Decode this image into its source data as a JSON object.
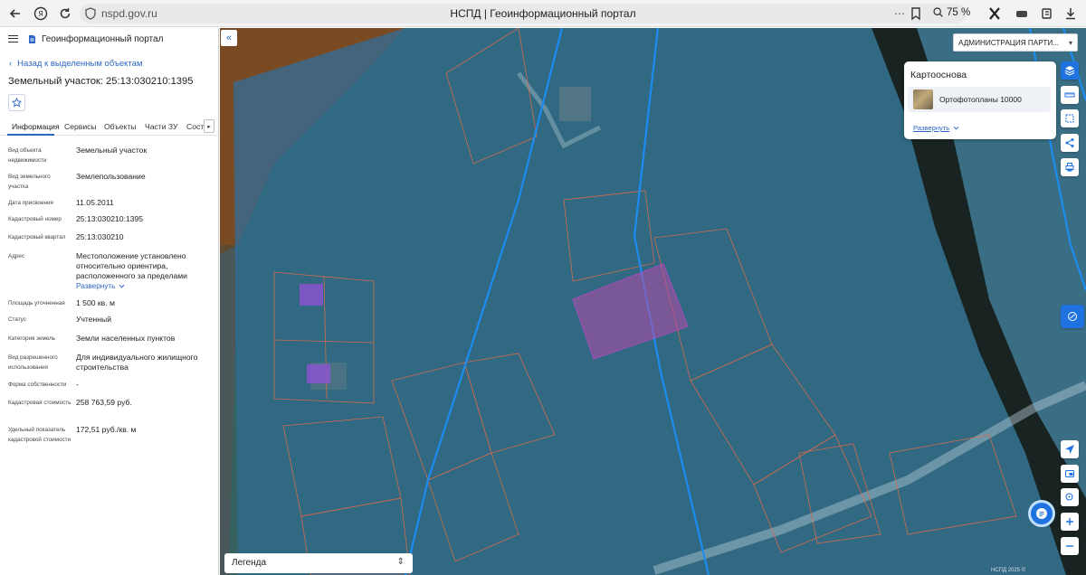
{
  "browser": {
    "url": "nspd.gov.ru",
    "page_title": "НСПД | Геоинформационный портал",
    "zoom": "75 %"
  },
  "left_panel": {
    "portal_name": "Геоинформационный портал",
    "back_link": "Назад к выделенным объектам",
    "title": "Земельный участок: 25:13:030210:1395",
    "tabs": [
      "Информация",
      "Сервисы",
      "Объекты",
      "Части ЗУ",
      "Соста"
    ],
    "active_tab": "Информация",
    "fields": [
      {
        "label": "Вид объекта недвижимости",
        "value": "Земельный участок"
      },
      {
        "label": "Вид земельного участка",
        "value": "Землепользование"
      },
      {
        "label": "Дата присвоения",
        "value": "11.05.2011"
      },
      {
        "label": "Кадастровый номер",
        "value": "25:13:030210:1395"
      },
      {
        "label": "Кадастровый квартал",
        "value": "25:13:030210"
      },
      {
        "label": "Адрес",
        "value": "Местоположение установлено относительно ориентира, расположенного за пределами"
      },
      {
        "label": "Площадь уточненная",
        "value": "1 500 кв. м"
      },
      {
        "label": "Статус",
        "value": "Учтенный"
      },
      {
        "label": "Категория земель",
        "value": "Земли населенных пунктов"
      },
      {
        "label": "Вид разрешенного использования",
        "value": "Для индивидуального жилищного строительства"
      },
      {
        "label": "Форма собственности",
        "value": "-"
      },
      {
        "label": "Кадастровая стоимость",
        "value": "258 763,59 руб."
      },
      {
        "label": "Удельный показатель кадастровой стоимости",
        "value": "172,51 руб./кв. м"
      }
    ],
    "expand_label": "Развернуть"
  },
  "map": {
    "admin_select": "АДМИНИСТРАЦИЯ ПАРТИ...",
    "basemap": {
      "title": "Картооснова",
      "item": "Ортофотопланы 10000",
      "expand": "Развернуть"
    },
    "legend_label": "Легенда",
    "copyright": "НСПД 2025 ©",
    "accent_color": "#1f73e0",
    "selected_parcel_color": "#c83cc8"
  }
}
